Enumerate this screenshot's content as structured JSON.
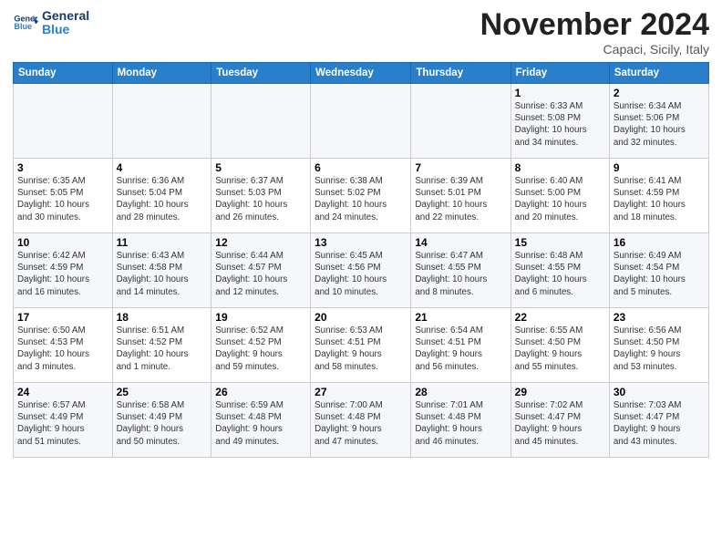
{
  "header": {
    "logo_general": "General",
    "logo_blue": "Blue",
    "month": "November 2024",
    "location": "Capaci, Sicily, Italy"
  },
  "weekdays": [
    "Sunday",
    "Monday",
    "Tuesday",
    "Wednesday",
    "Thursday",
    "Friday",
    "Saturday"
  ],
  "weeks": [
    [
      {
        "day": "",
        "info": ""
      },
      {
        "day": "",
        "info": ""
      },
      {
        "day": "",
        "info": ""
      },
      {
        "day": "",
        "info": ""
      },
      {
        "day": "",
        "info": ""
      },
      {
        "day": "1",
        "info": "Sunrise: 6:33 AM\nSunset: 5:08 PM\nDaylight: 10 hours\nand 34 minutes."
      },
      {
        "day": "2",
        "info": "Sunrise: 6:34 AM\nSunset: 5:06 PM\nDaylight: 10 hours\nand 32 minutes."
      }
    ],
    [
      {
        "day": "3",
        "info": "Sunrise: 6:35 AM\nSunset: 5:05 PM\nDaylight: 10 hours\nand 30 minutes."
      },
      {
        "day": "4",
        "info": "Sunrise: 6:36 AM\nSunset: 5:04 PM\nDaylight: 10 hours\nand 28 minutes."
      },
      {
        "day": "5",
        "info": "Sunrise: 6:37 AM\nSunset: 5:03 PM\nDaylight: 10 hours\nand 26 minutes."
      },
      {
        "day": "6",
        "info": "Sunrise: 6:38 AM\nSunset: 5:02 PM\nDaylight: 10 hours\nand 24 minutes."
      },
      {
        "day": "7",
        "info": "Sunrise: 6:39 AM\nSunset: 5:01 PM\nDaylight: 10 hours\nand 22 minutes."
      },
      {
        "day": "8",
        "info": "Sunrise: 6:40 AM\nSunset: 5:00 PM\nDaylight: 10 hours\nand 20 minutes."
      },
      {
        "day": "9",
        "info": "Sunrise: 6:41 AM\nSunset: 4:59 PM\nDaylight: 10 hours\nand 18 minutes."
      }
    ],
    [
      {
        "day": "10",
        "info": "Sunrise: 6:42 AM\nSunset: 4:59 PM\nDaylight: 10 hours\nand 16 minutes."
      },
      {
        "day": "11",
        "info": "Sunrise: 6:43 AM\nSunset: 4:58 PM\nDaylight: 10 hours\nand 14 minutes."
      },
      {
        "day": "12",
        "info": "Sunrise: 6:44 AM\nSunset: 4:57 PM\nDaylight: 10 hours\nand 12 minutes."
      },
      {
        "day": "13",
        "info": "Sunrise: 6:45 AM\nSunset: 4:56 PM\nDaylight: 10 hours\nand 10 minutes."
      },
      {
        "day": "14",
        "info": "Sunrise: 6:47 AM\nSunset: 4:55 PM\nDaylight: 10 hours\nand 8 minutes."
      },
      {
        "day": "15",
        "info": "Sunrise: 6:48 AM\nSunset: 4:55 PM\nDaylight: 10 hours\nand 6 minutes."
      },
      {
        "day": "16",
        "info": "Sunrise: 6:49 AM\nSunset: 4:54 PM\nDaylight: 10 hours\nand 5 minutes."
      }
    ],
    [
      {
        "day": "17",
        "info": "Sunrise: 6:50 AM\nSunset: 4:53 PM\nDaylight: 10 hours\nand 3 minutes."
      },
      {
        "day": "18",
        "info": "Sunrise: 6:51 AM\nSunset: 4:52 PM\nDaylight: 10 hours\nand 1 minute."
      },
      {
        "day": "19",
        "info": "Sunrise: 6:52 AM\nSunset: 4:52 PM\nDaylight: 9 hours\nand 59 minutes."
      },
      {
        "day": "20",
        "info": "Sunrise: 6:53 AM\nSunset: 4:51 PM\nDaylight: 9 hours\nand 58 minutes."
      },
      {
        "day": "21",
        "info": "Sunrise: 6:54 AM\nSunset: 4:51 PM\nDaylight: 9 hours\nand 56 minutes."
      },
      {
        "day": "22",
        "info": "Sunrise: 6:55 AM\nSunset: 4:50 PM\nDaylight: 9 hours\nand 55 minutes."
      },
      {
        "day": "23",
        "info": "Sunrise: 6:56 AM\nSunset: 4:50 PM\nDaylight: 9 hours\nand 53 minutes."
      }
    ],
    [
      {
        "day": "24",
        "info": "Sunrise: 6:57 AM\nSunset: 4:49 PM\nDaylight: 9 hours\nand 51 minutes."
      },
      {
        "day": "25",
        "info": "Sunrise: 6:58 AM\nSunset: 4:49 PM\nDaylight: 9 hours\nand 50 minutes."
      },
      {
        "day": "26",
        "info": "Sunrise: 6:59 AM\nSunset: 4:48 PM\nDaylight: 9 hours\nand 49 minutes."
      },
      {
        "day": "27",
        "info": "Sunrise: 7:00 AM\nSunset: 4:48 PM\nDaylight: 9 hours\nand 47 minutes."
      },
      {
        "day": "28",
        "info": "Sunrise: 7:01 AM\nSunset: 4:48 PM\nDaylight: 9 hours\nand 46 minutes."
      },
      {
        "day": "29",
        "info": "Sunrise: 7:02 AM\nSunset: 4:47 PM\nDaylight: 9 hours\nand 45 minutes."
      },
      {
        "day": "30",
        "info": "Sunrise: 7:03 AM\nSunset: 4:47 PM\nDaylight: 9 hours\nand 43 minutes."
      }
    ]
  ]
}
